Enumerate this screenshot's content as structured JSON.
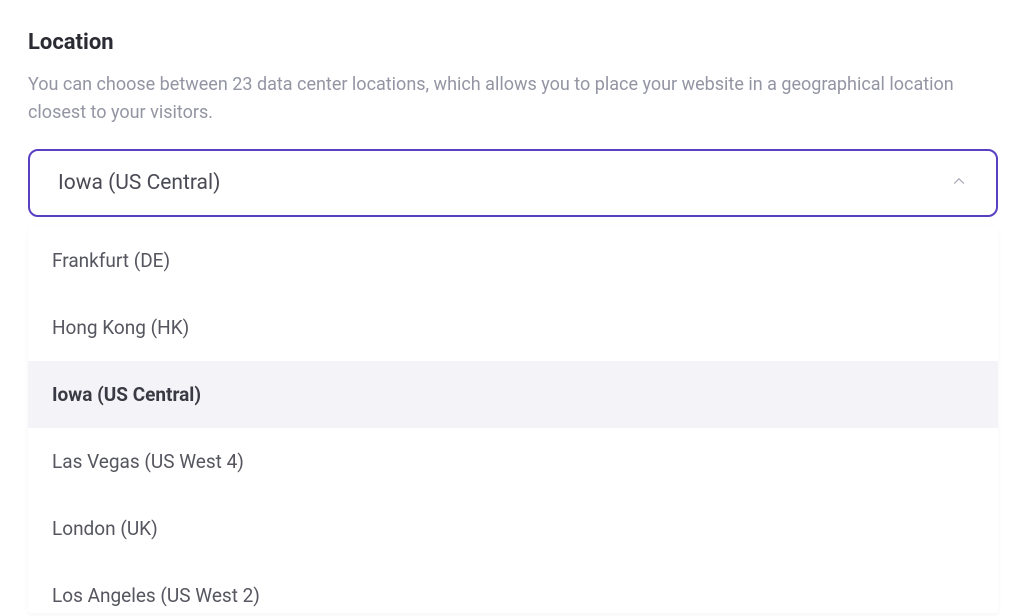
{
  "location": {
    "title": "Location",
    "description": "You can choose between 23 data center locations, which allows you to place your website in a geographical location closest to your visitors.",
    "selected": "Iowa (US Central)",
    "options": [
      {
        "label": "Frankfurt (DE)",
        "selected": false
      },
      {
        "label": "Hong Kong (HK)",
        "selected": false
      },
      {
        "label": "Iowa (US Central)",
        "selected": true
      },
      {
        "label": "Las Vegas (US West 4)",
        "selected": false
      },
      {
        "label": "London (UK)",
        "selected": false
      },
      {
        "label": "Los Angeles (US West 2)",
        "selected": false
      }
    ]
  }
}
